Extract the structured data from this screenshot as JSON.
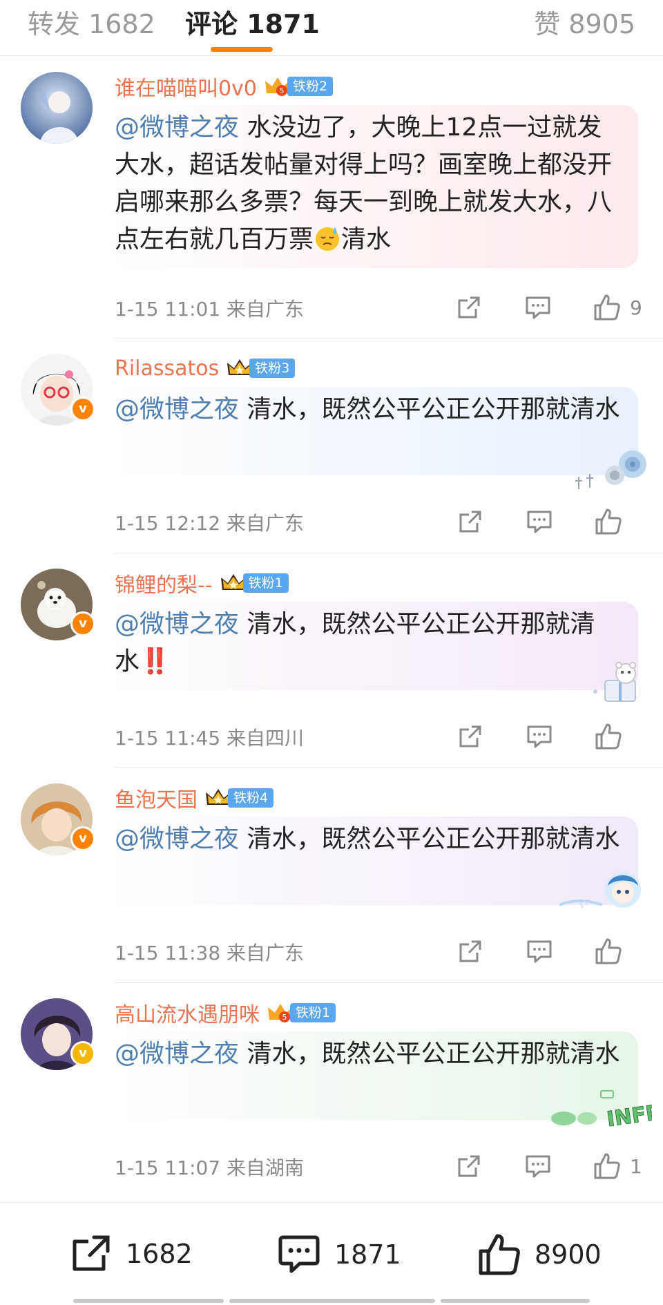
{
  "tabs": {
    "reposts": "转发 1682",
    "comments": "评论 1871",
    "likes": "赞 8905"
  },
  "comments": [
    {
      "username": "谁在喵喵叫0v0",
      "fan_badge": "铁粉2",
      "mention": "@微博之夜",
      "text_before_emoji": " 水没边了，大晚上12点一过就发大水，超话发帖量对得上吗？画室晚上都没开启哪来那么多票？每天一到晚上就发大水，八点左右就几百万票",
      "emoji": "sweat-face-emoji",
      "text_after_emoji": "清水",
      "time": "1-15 11:01",
      "location": "来自广东",
      "likes": "9"
    },
    {
      "username": "Rilassatos",
      "fan_badge": "铁粉3",
      "mention": "@微博之夜",
      "text": " 清水，既然公平公正公开那就清水",
      "time": "1-15 12:12",
      "location": "来自广东",
      "likes": ""
    },
    {
      "username": "锦鲤的梨--",
      "fan_badge": "铁粉1",
      "mention": "@微博之夜",
      "text": " 清水，既然公平公正公开那就清水",
      "emoji_after": "‼️",
      "time": "1-15 11:45",
      "location": "来自四川",
      "likes": ""
    },
    {
      "username": "鱼泡天国",
      "fan_badge": "铁粉4",
      "mention": "@微博之夜",
      "text": " 清水，既然公平公正公开那就清水",
      "time": "1-15 11:38",
      "location": "来自广东",
      "likes": ""
    },
    {
      "username": "高山流水遇朋咪",
      "fan_badge": "铁粉1",
      "mention": "@微博之夜",
      "text": " 清水，既然公平公正公开那就清水",
      "sticker_text": "INFP",
      "time": "1-15 11:07",
      "location": "来自湖南",
      "likes": "1"
    }
  ],
  "bottom_bar": {
    "reposts": "1682",
    "comments": "1871",
    "likes": "8900"
  },
  "colors": {
    "accent": "#ff8200",
    "username": "#eb7350",
    "mention": "#507daf",
    "fan_badge": "#5ba7ef",
    "meta": "#8a8a8a"
  }
}
